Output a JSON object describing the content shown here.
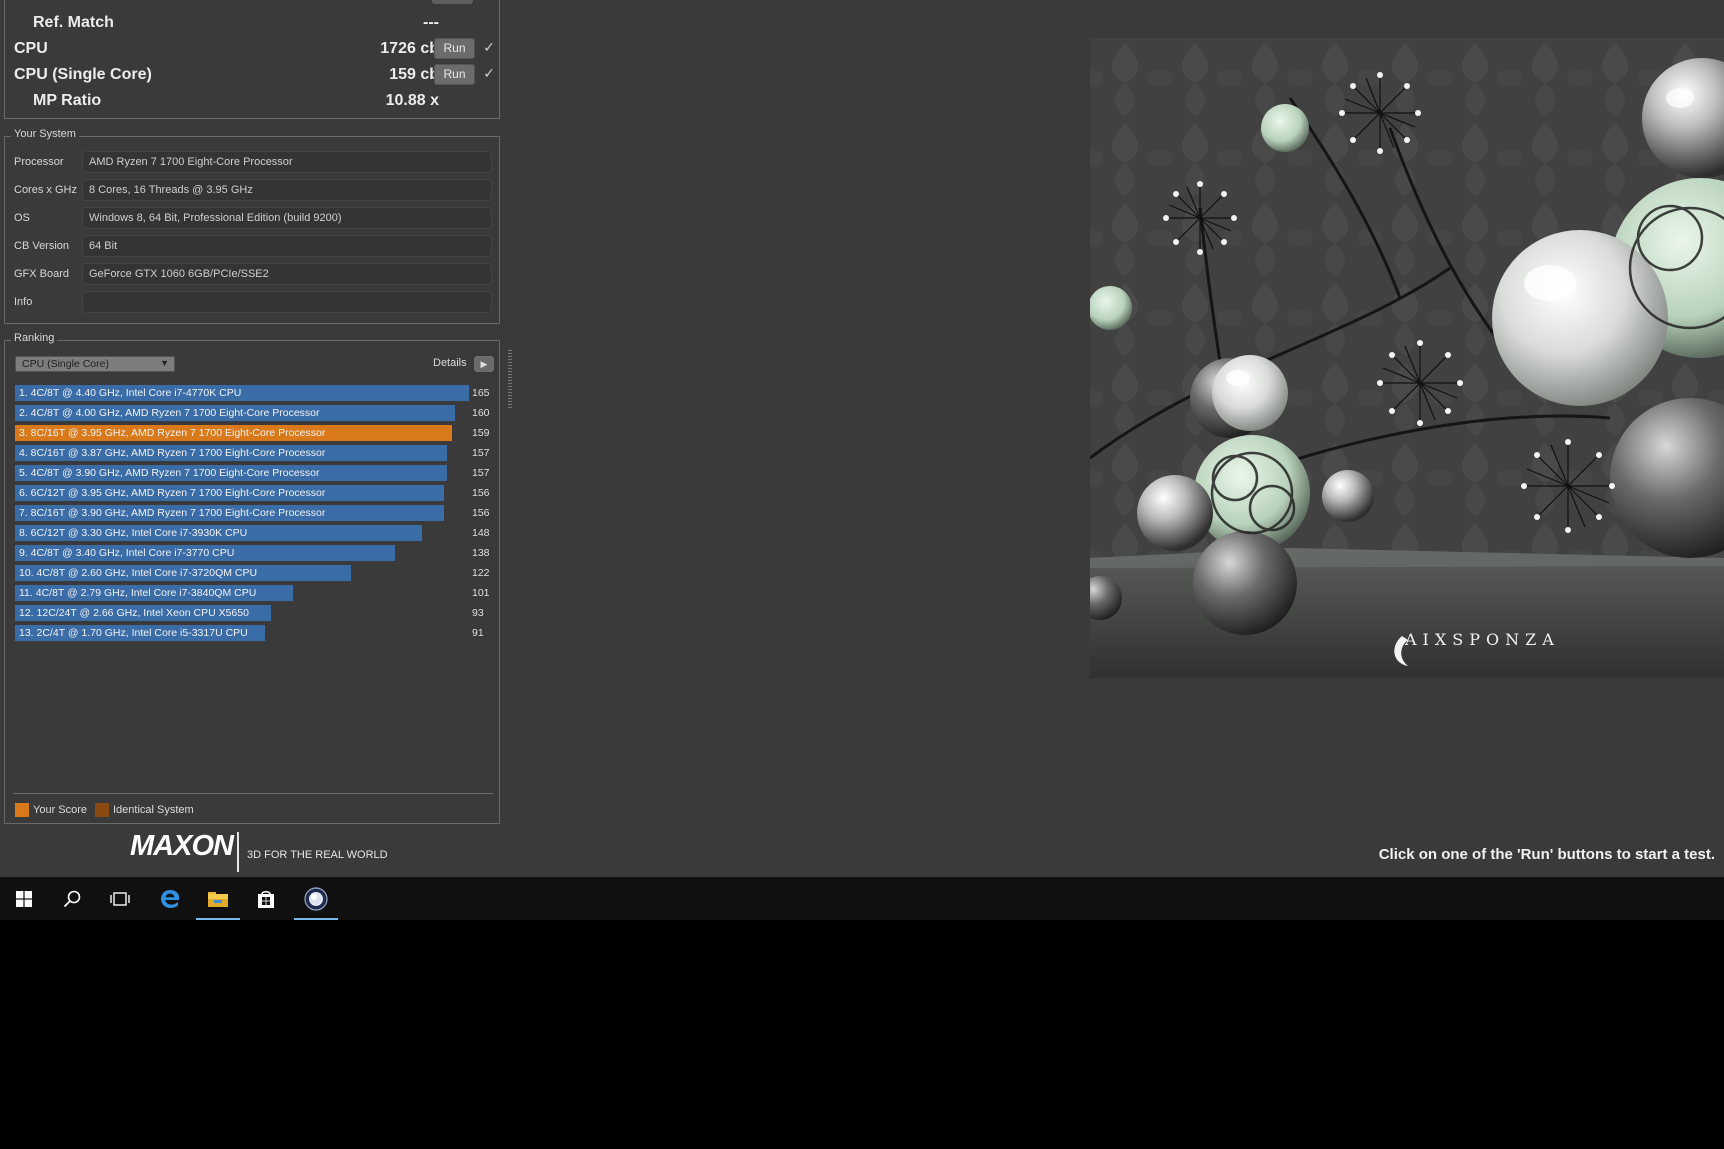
{
  "results": {
    "rows": [
      {
        "label": "Ref. Match",
        "value": "---",
        "indent": true,
        "run": false
      },
      {
        "label": "CPU",
        "value": "1726 cb",
        "indent": false,
        "run": true,
        "run_label": "Run",
        "checked": "✓"
      },
      {
        "label": "CPU (Single Core)",
        "value": "159 cb",
        "indent": false,
        "run": true,
        "run_label": "Run",
        "checked": "✓"
      },
      {
        "label": "MP Ratio",
        "value": "10.88 x",
        "indent": true,
        "run": false
      }
    ]
  },
  "your_system": {
    "title": "Your System",
    "fields": [
      {
        "label": "Processor",
        "value": "AMD Ryzen 7 1700 Eight-Core Processor"
      },
      {
        "label": "Cores x GHz",
        "value": "8 Cores, 16 Threads @ 3.95 GHz"
      },
      {
        "label": "OS",
        "value": "Windows 8, 64 Bit, Professional Edition (build 9200)"
      },
      {
        "label": "CB Version",
        "value": "64 Bit"
      },
      {
        "label": "GFX Board",
        "value": "GeForce GTX 1060 6GB/PCIe/SSE2"
      },
      {
        "label": "Info",
        "value": ""
      }
    ]
  },
  "ranking": {
    "title": "Ranking",
    "selected": "CPU (Single Core)",
    "details_label": "Details",
    "max_score": 165,
    "entries": [
      {
        "label": "1. 4C/8T @ 4.40 GHz, Intel Core i7-4770K CPU",
        "score": 165,
        "yours": false
      },
      {
        "label": "2. 4C/8T @ 4.00 GHz, AMD Ryzen 7 1700 Eight-Core Processor",
        "score": 160,
        "yours": false
      },
      {
        "label": "3. 8C/16T @ 3.95 GHz, AMD Ryzen 7 1700 Eight-Core Processor",
        "score": 159,
        "yours": true
      },
      {
        "label": "4. 8C/16T @ 3.87 GHz, AMD Ryzen 7 1700 Eight-Core Processor",
        "score": 157,
        "yours": false
      },
      {
        "label": "5. 4C/8T @ 3.90 GHz, AMD Ryzen 7 1700 Eight-Core Processor",
        "score": 157,
        "yours": false
      },
      {
        "label": "6. 6C/12T @ 3.95 GHz, AMD Ryzen 7 1700 Eight-Core Processor",
        "score": 156,
        "yours": false
      },
      {
        "label": "7. 8C/16T @ 3.90 GHz, AMD Ryzen 7 1700 Eight-Core Processor",
        "score": 156,
        "yours": false
      },
      {
        "label": "8. 6C/12T @ 3.30 GHz,  Intel Core i7-3930K CPU",
        "score": 148,
        "yours": false
      },
      {
        "label": "9. 4C/8T @ 3.40 GHz,  Intel Core i7-3770 CPU",
        "score": 138,
        "yours": false
      },
      {
        "label": "10. 4C/8T @ 2.60 GHz, Intel Core i7-3720QM CPU",
        "score": 122,
        "yours": false
      },
      {
        "label": "11. 4C/8T @ 2.79 GHz,  Intel Core i7-3840QM CPU",
        "score": 101,
        "yours": false
      },
      {
        "label": "12. 12C/24T @ 2.66 GHz, Intel Xeon CPU X5650",
        "score": 93,
        "yours": false
      },
      {
        "label": "13. 2C/4T @ 1.70 GHz,  Intel Core i5-3317U CPU",
        "score": 91,
        "yours": false
      }
    ],
    "legend": [
      {
        "label": "Your Score",
        "color": "#d9791a"
      },
      {
        "label": "Identical System",
        "color": "#8a4a12"
      }
    ]
  },
  "footer": {
    "logo": "MAXON",
    "tagline": "3D FOR THE REAL WORLD",
    "status": "Click on one of the 'Run' buttons to start a test."
  },
  "render": {
    "watermark": "AIXSPONZA"
  },
  "colors": {
    "bar": "#3a6ca8",
    "your_score": "#d9791a",
    "identical_system": "#8a4a12",
    "app_bg": "#3a3a3a",
    "taskbar_bg": "#101010"
  },
  "taskbar": {
    "items": [
      {
        "name": "start-icon",
        "active": false
      },
      {
        "name": "search-icon",
        "active": false
      },
      {
        "name": "task-view-icon",
        "active": false
      },
      {
        "name": "edge-icon",
        "active": false
      },
      {
        "name": "file-explorer-icon",
        "active": true
      },
      {
        "name": "store-icon",
        "active": false
      },
      {
        "name": "cinebench-icon",
        "active": true
      }
    ]
  }
}
